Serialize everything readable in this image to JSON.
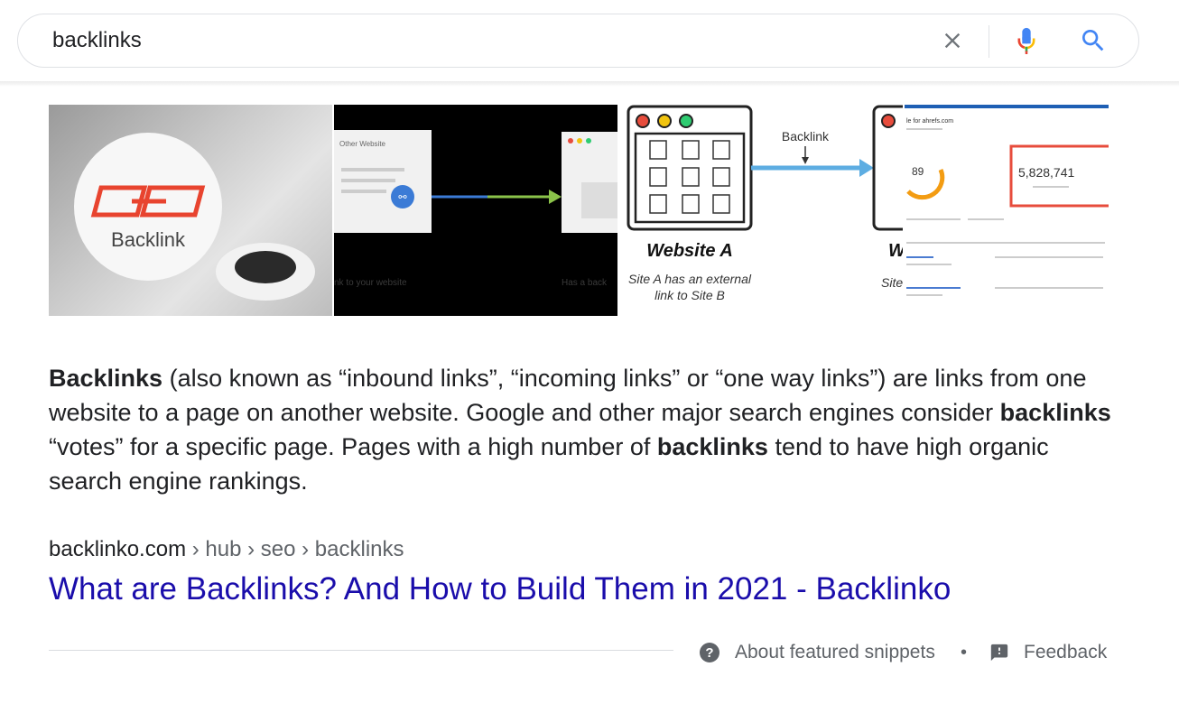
{
  "search": {
    "query": "backlinks"
  },
  "images": [
    {
      "label": "Backlink",
      "caption": ""
    },
    {
      "header": "Other Website",
      "left_text": "nk to your website",
      "right_text": "Has a back"
    },
    {
      "arrow_label": "Backlink",
      "site_title": "Website A",
      "caption_line1": "Site A has an external",
      "caption_line2": "link to Site B",
      "cut_title": "W",
      "cut_caption": "Site"
    },
    {
      "header": "le for ahrefs.com",
      "metric_small": "89",
      "metric_big": "5,828,741"
    }
  ],
  "snippet": {
    "p1_bold": "Backlinks",
    "p1_text": " (also known as “inbound links”, “incoming links” or “one way links”) are links from one website to a page on another website. Google and other major search engines consider ",
    "p2_bold": "backlinks",
    "p2_text": " “votes” for a specific page. Pages with a high number of ",
    "p3_bold": "backlinks",
    "p3_text": " tend to have high organic search engine rankings."
  },
  "result": {
    "domain": "backlinko.com",
    "breadcrumb": " › hub › seo › backlinks",
    "title": "What are Backlinks? And How to Build Them in 2021 - Backlinko"
  },
  "footer": {
    "about_label": "About featured snippets",
    "separator": "•",
    "feedback_label": "Feedback"
  },
  "colors": {
    "link": "#1a0dab",
    "accent_blue": "#4285f4",
    "mic_red": "#ea4335",
    "mic_yellow": "#fbbc05",
    "mic_green": "#34a853",
    "backlink_logo_red": "#e8442f"
  },
  "icons": [
    "close-icon",
    "microphone-icon",
    "search-icon",
    "help-circle-icon",
    "feedback-icon",
    "link-icon"
  ]
}
